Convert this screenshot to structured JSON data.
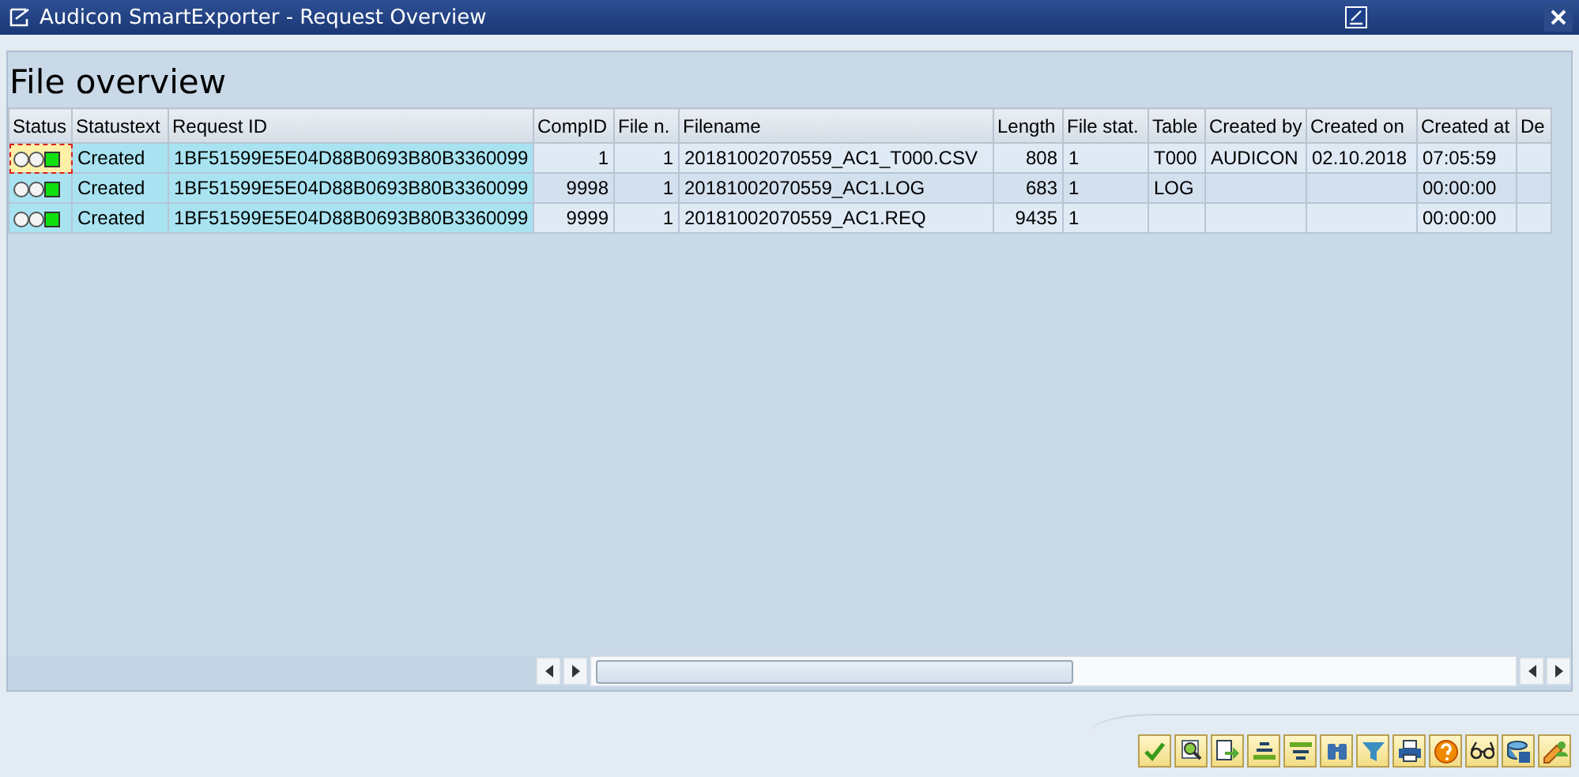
{
  "window": {
    "title": "Audicon SmartExporter - Request Overview"
  },
  "heading": "File overview",
  "table": {
    "columns": [
      {
        "label": "Status",
        "key": true
      },
      {
        "label": "Statustext",
        "key": true
      },
      {
        "label": "Request ID",
        "key": true
      },
      {
        "label": "CompID",
        "key": false
      },
      {
        "label": "File n.",
        "key": false
      },
      {
        "label": "Filename",
        "key": false
      },
      {
        "label": "Length",
        "key": false
      },
      {
        "label": "File stat.",
        "key": false
      },
      {
        "label": "Table",
        "key": false
      },
      {
        "label": "Created by",
        "key": false
      },
      {
        "label": "Created on",
        "key": false
      },
      {
        "label": "Created at",
        "key": false
      },
      {
        "label": "De",
        "key": false
      }
    ],
    "rows": [
      {
        "selected": true,
        "color": "#10e010",
        "cells": [
          "",
          "Created",
          "1BF51599E5E04D88B0693B80B3360099",
          "1",
          "1",
          "20181002070559_AC1_T000.CSV",
          "808",
          "1",
          "T000",
          "AUDICON",
          "02.10.2018",
          "07:05:59"
        ]
      },
      {
        "selected": false,
        "color": "#10e010",
        "cells": [
          "",
          "Created",
          "1BF51599E5E04D88B0693B80B3360099",
          "9998",
          "1",
          "20181002070559_AC1.LOG",
          "683",
          "1",
          "LOG",
          "",
          "",
          "00:00:00"
        ]
      },
      {
        "selected": false,
        "color": "#10e010",
        "cells": [
          "",
          "Created",
          "1BF51599E5E04D88B0693B80B3360099",
          "9999",
          "1",
          "20181002070559_AC1.REQ",
          "9435",
          "1",
          "",
          "",
          "",
          "00:00:00"
        ]
      }
    ]
  }
}
